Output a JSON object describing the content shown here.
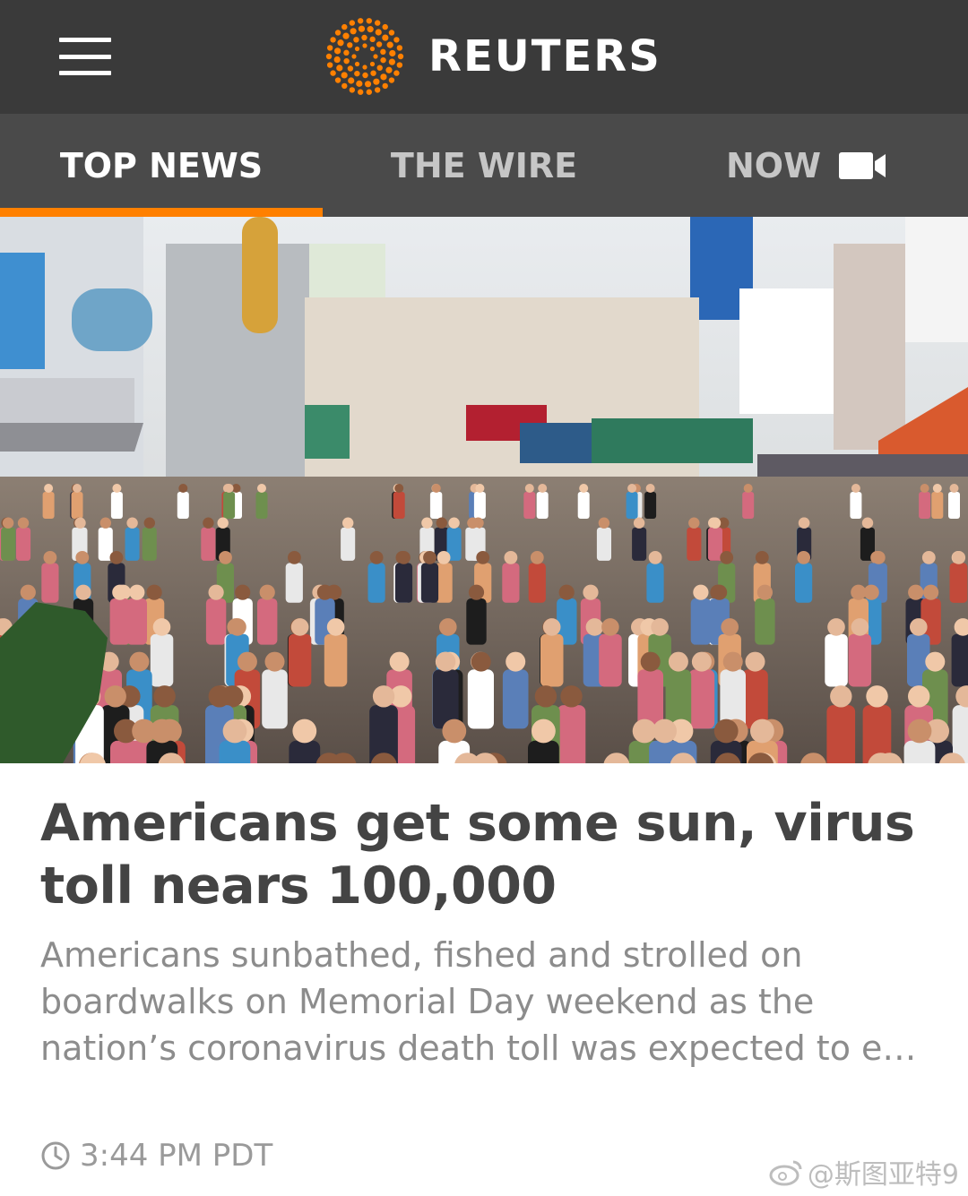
{
  "header": {
    "brand": "REUTERS",
    "menu_icon": "hamburger-menu-icon",
    "logo_icon": "reuters-dot-logo-icon",
    "colors": {
      "bar": "#3a3a3a",
      "logo": "#ff8000"
    }
  },
  "tabs": [
    {
      "label": "TOP NEWS",
      "active": true
    },
    {
      "label": "THE WIRE",
      "active": false
    },
    {
      "label": "NOW",
      "active": false,
      "icon": "video-camera-icon"
    }
  ],
  "article": {
    "image_description_icon": "boardwalk-photo",
    "headline": "Americans get some sun, virus toll nears 100,000",
    "summary": "Americans sunbathed, fished and strolled on boardwalks on Memorial Day weekend as the nation’s coronavirus death toll was expected to e…",
    "time": "3:44 PM PDT",
    "time_icon": "clock-icon"
  },
  "watermark": {
    "text": "@斯图亚特9",
    "icon": "weibo-icon"
  },
  "accent": "#ff8000"
}
